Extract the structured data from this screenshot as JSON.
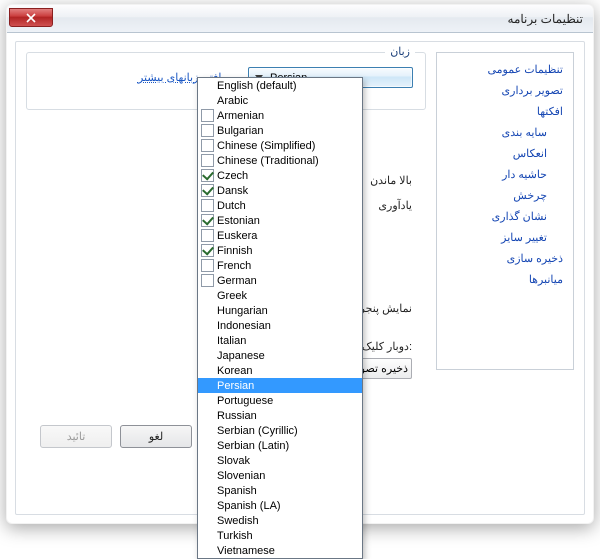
{
  "window": {
    "title": "تنظیمات برنامه"
  },
  "sidebar": {
    "items": [
      "تنظیمات عمومی",
      "تصویر برداری",
      "افکتها",
      "سایه بندی",
      "انعکاس",
      "حاشیه دار",
      "چرخش",
      "نشان گذاری",
      "تغییر سایز",
      "ذخیره سازی",
      "میانبرها"
    ],
    "subIndices": [
      3,
      4,
      5,
      6,
      7,
      8
    ]
  },
  "lang": {
    "legend": "زبان",
    "selected": "Persian",
    "more_link": "...یافتن زبانهای بیشتر",
    "options": [
      {
        "label": "English (default)"
      },
      {
        "label": "Arabic"
      },
      {
        "label": "Armenian",
        "checkbox": true,
        "checked": false
      },
      {
        "label": "Bulgarian",
        "checkbox": true,
        "checked": false
      },
      {
        "label": "Chinese (Simplified)",
        "checkbox": true,
        "checked": false
      },
      {
        "label": "Chinese (Traditional)",
        "checkbox": true,
        "checked": false
      },
      {
        "label": "Czech",
        "checkbox": true,
        "checked": true
      },
      {
        "label": "Dansk",
        "checkbox": true,
        "checked": true
      },
      {
        "label": "Dutch",
        "checkbox": true,
        "checked": false
      },
      {
        "label": "Estonian",
        "checkbox": true,
        "checked": true
      },
      {
        "label": "Euskera",
        "checkbox": true,
        "checked": false
      },
      {
        "label": "Finnish",
        "checkbox": true,
        "checked": true
      },
      {
        "label": "French",
        "checkbox": true,
        "checked": false
      },
      {
        "label": "German",
        "checkbox": true,
        "checked": false
      },
      {
        "label": "Greek"
      },
      {
        "label": "Hungarian"
      },
      {
        "label": "Indonesian"
      },
      {
        "label": "Italian"
      },
      {
        "label": "Japanese"
      },
      {
        "label": "Korean"
      },
      {
        "label": "Persian",
        "selected": true
      },
      {
        "label": "Portuguese"
      },
      {
        "label": "Russian"
      },
      {
        "label": "Serbian (Cyrillic)"
      },
      {
        "label": "Serbian (Latin)"
      },
      {
        "label": "Slovak"
      },
      {
        "label": "Slovenian"
      },
      {
        "label": "Spanish"
      },
      {
        "label": "Spanish (LA)"
      },
      {
        "label": "Swedish"
      },
      {
        "label": "Turkish"
      },
      {
        "label": "Vietnamese"
      }
    ]
  },
  "background_text": {
    "line1": "بالا ماندن",
    "line2": "یادآوری"
  },
  "dialog_show_text": "نمایش پنجره دیالوگ",
  "dblclick": {
    "label": ":دوبار کلیک در فضای خالی",
    "value": "ذخیره تصویر"
  },
  "buttons": {
    "ok": "تائید",
    "cancel": "لغو"
  }
}
